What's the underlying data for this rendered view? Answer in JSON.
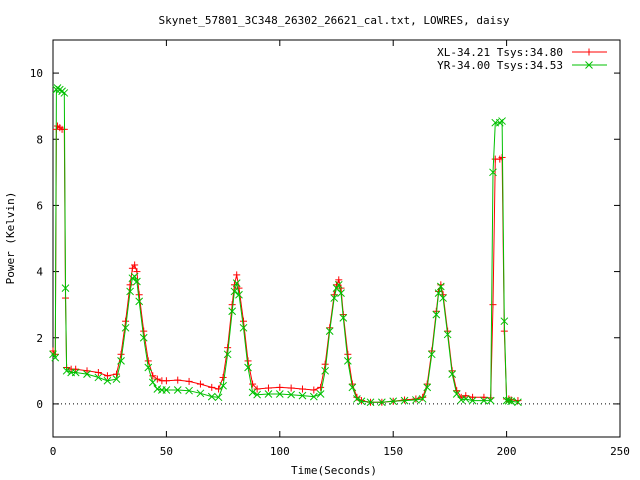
{
  "chart_data": {
    "type": "line",
    "title": "Skynet_57801_3C348_26302_26621_cal.txt, LOWRES, daisy",
    "xlabel": "Time(Seconds)",
    "ylabel": "Power (Kelvin)",
    "xlim": [
      0,
      250
    ],
    "ylim": [
      -1,
      11
    ],
    "xticks": [
      0,
      50,
      100,
      150,
      200,
      250
    ],
    "yticks": [
      0,
      2,
      4,
      6,
      8,
      10
    ],
    "grid": false,
    "legend_position": "top-right",
    "series": [
      {
        "name": "XL-34.21 Tsys:34.80",
        "color": "#ff0000",
        "marker": "plus",
        "x": [
          0,
          1,
          1.5,
          2,
          3,
          4,
          5,
          5.5,
          6,
          8,
          10,
          15,
          20,
          24,
          28,
          30,
          32,
          34,
          35,
          36,
          37,
          38,
          40,
          42,
          44,
          46,
          48,
          50,
          55,
          60,
          65,
          70,
          73,
          75,
          77,
          79,
          80,
          81,
          82,
          84,
          86,
          88,
          90,
          95,
          100,
          105,
          110,
          115,
          118,
          120,
          122,
          124,
          125,
          126,
          127,
          128,
          130,
          132,
          134,
          136,
          140,
          145,
          150,
          155,
          160,
          163,
          165,
          167,
          169,
          170,
          171,
          172,
          174,
          176,
          178,
          180,
          182,
          185,
          190,
          193,
          194,
          195,
          197,
          198,
          199,
          200,
          201,
          202,
          205
        ],
        "y": [
          1.6,
          1.5,
          8.3,
          8.4,
          8.35,
          8.3,
          8.3,
          3.2,
          1.1,
          1.05,
          1.05,
          1.0,
          0.95,
          0.85,
          0.9,
          1.5,
          2.5,
          3.6,
          4.1,
          4.2,
          4.0,
          3.3,
          2.2,
          1.3,
          0.85,
          0.75,
          0.7,
          0.7,
          0.72,
          0.68,
          0.6,
          0.5,
          0.45,
          0.8,
          1.7,
          3.0,
          3.6,
          3.9,
          3.5,
          2.5,
          1.3,
          0.6,
          0.45,
          0.48,
          0.5,
          0.48,
          0.45,
          0.42,
          0.5,
          1.2,
          2.3,
          3.3,
          3.6,
          3.75,
          3.5,
          2.7,
          1.5,
          0.6,
          0.2,
          0.1,
          0.05,
          0.05,
          0.08,
          0.12,
          0.15,
          0.2,
          0.6,
          1.6,
          2.8,
          3.4,
          3.6,
          3.3,
          2.2,
          1.0,
          0.4,
          0.2,
          0.25,
          0.2,
          0.2,
          0.18,
          3.0,
          7.4,
          7.4,
          7.45,
          2.2,
          0.15,
          0.15,
          0.12,
          0.1
        ]
      },
      {
        "name": "YR-34.00 Tsys:34.53",
        "color": "#00c000",
        "marker": "cross",
        "x": [
          0,
          1,
          1.5,
          2,
          3,
          4,
          5,
          5.5,
          6,
          8,
          10,
          15,
          20,
          24,
          28,
          30,
          32,
          34,
          35,
          36,
          37,
          38,
          40,
          42,
          44,
          46,
          48,
          50,
          55,
          60,
          65,
          70,
          73,
          75,
          77,
          79,
          80,
          81,
          82,
          84,
          86,
          88,
          90,
          95,
          100,
          105,
          110,
          115,
          118,
          120,
          122,
          124,
          125,
          126,
          127,
          128,
          130,
          132,
          134,
          136,
          140,
          145,
          150,
          155,
          160,
          163,
          165,
          167,
          169,
          170,
          171,
          172,
          174,
          176,
          178,
          180,
          182,
          185,
          190,
          193,
          194,
          195,
          197,
          198,
          199,
          200,
          201,
          202,
          205
        ],
        "y": [
          1.5,
          1.4,
          9.5,
          9.55,
          9.5,
          9.45,
          9.4,
          3.5,
          1.0,
          0.95,
          0.95,
          0.9,
          0.8,
          0.7,
          0.75,
          1.3,
          2.3,
          3.4,
          3.8,
          3.85,
          3.7,
          3.1,
          2.0,
          1.1,
          0.65,
          0.45,
          0.42,
          0.42,
          0.42,
          0.4,
          0.32,
          0.22,
          0.2,
          0.55,
          1.5,
          2.8,
          3.4,
          3.65,
          3.3,
          2.3,
          1.1,
          0.35,
          0.28,
          0.3,
          0.3,
          0.28,
          0.25,
          0.22,
          0.3,
          1.0,
          2.2,
          3.2,
          3.5,
          3.6,
          3.35,
          2.6,
          1.3,
          0.5,
          0.15,
          0.08,
          0.05,
          0.05,
          0.08,
          0.1,
          0.12,
          0.15,
          0.5,
          1.5,
          2.7,
          3.35,
          3.55,
          3.2,
          2.1,
          0.9,
          0.3,
          0.12,
          0.15,
          0.1,
          0.1,
          0.1,
          7.0,
          8.5,
          8.5,
          8.55,
          2.5,
          0.1,
          0.1,
          0.08,
          0.05
        ]
      }
    ]
  }
}
